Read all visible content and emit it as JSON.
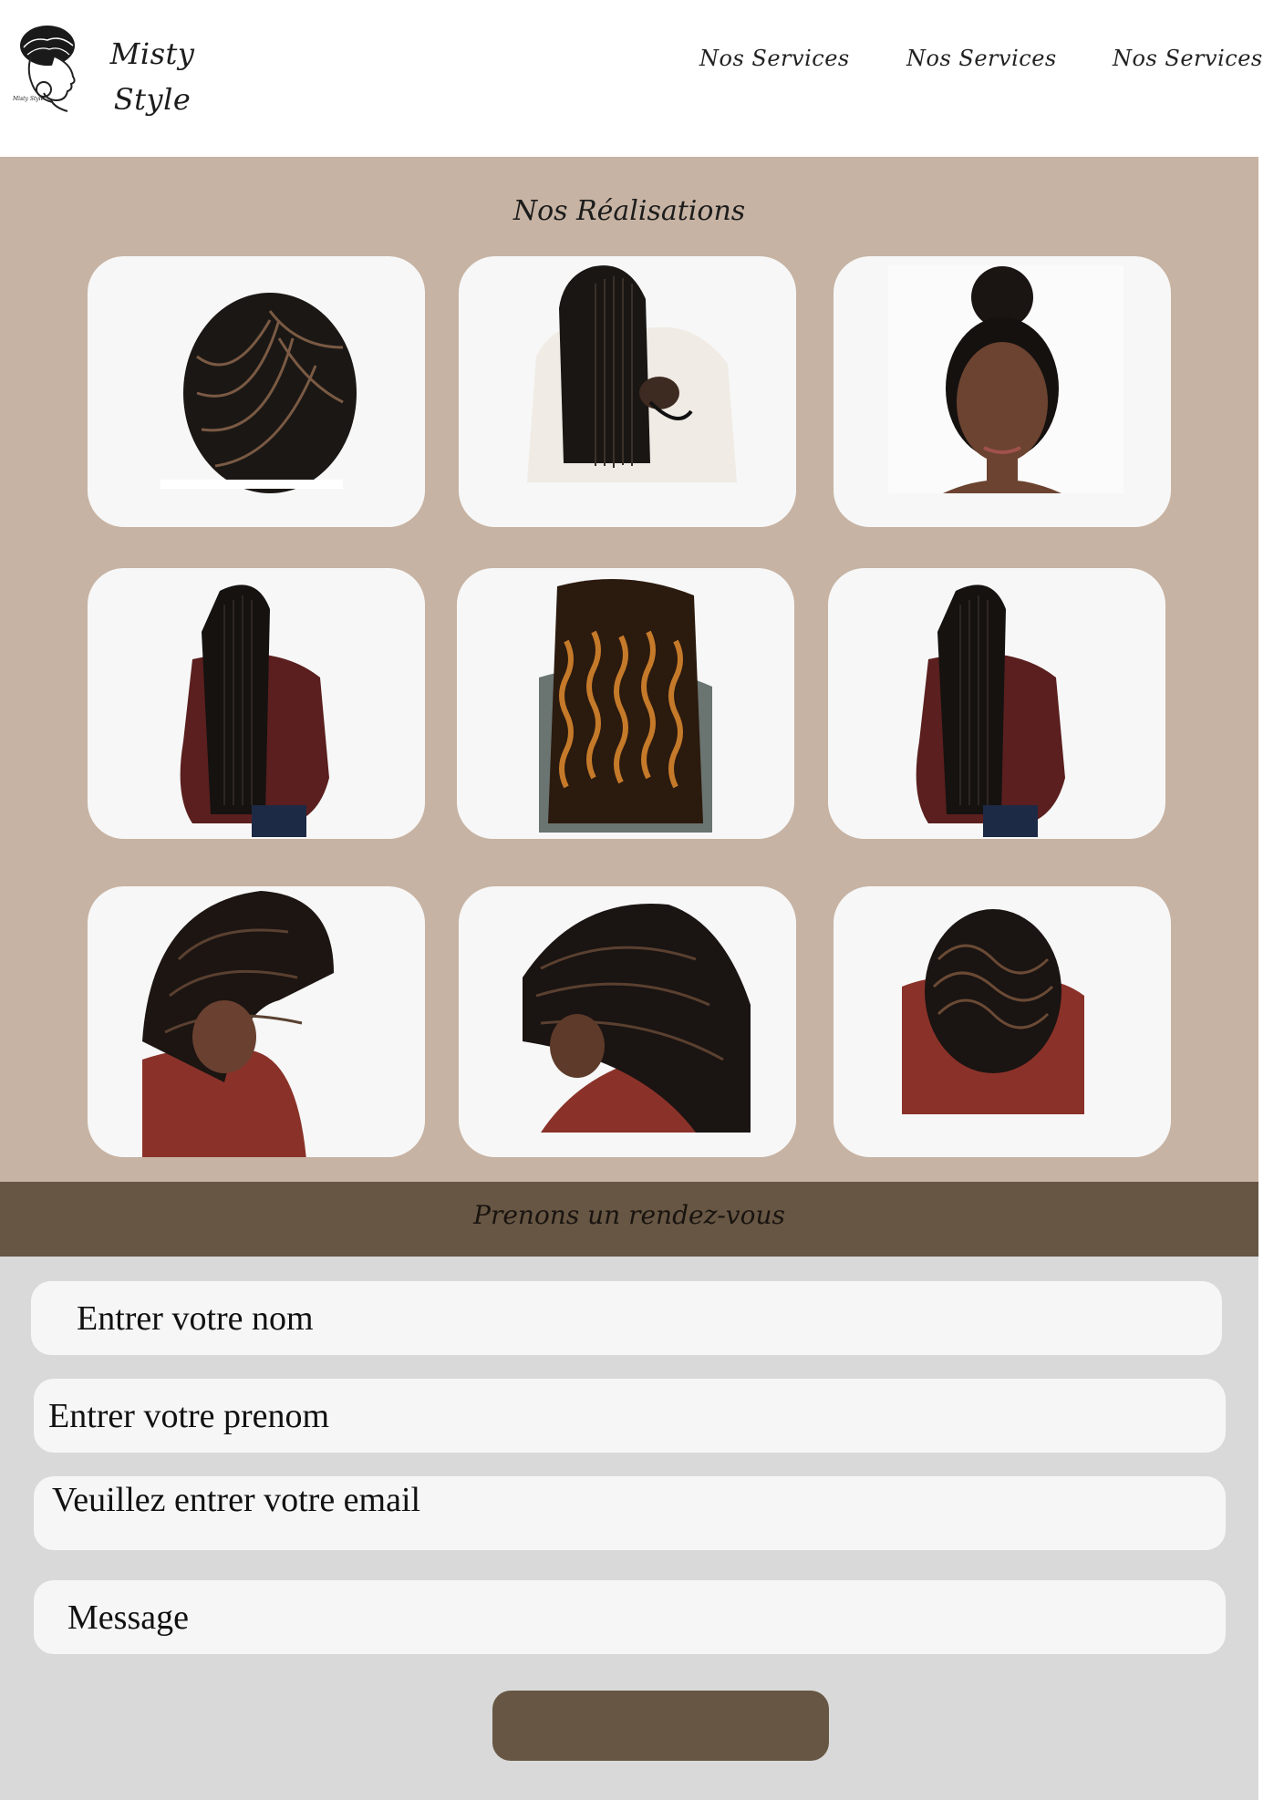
{
  "header": {
    "brand_line1": "Misty",
    "brand_line2": "Style",
    "logo_caption": "Misty Style",
    "nav": [
      "Nos Services",
      "Nos Services",
      "Nos Services"
    ]
  },
  "gallery": {
    "title": "Nos Réalisations",
    "items": [
      {
        "name": "cornrows-back-view"
      },
      {
        "name": "long-braids-front-view"
      },
      {
        "name": "high-bun-portrait"
      },
      {
        "name": "long-braids-curly-ends-back"
      },
      {
        "name": "curly-boho-braids-back"
      },
      {
        "name": "long-braids-curly-ends-side"
      },
      {
        "name": "stitch-braids-side"
      },
      {
        "name": "braids-bent-head"
      },
      {
        "name": "stitch-braids-top-view"
      }
    ]
  },
  "appointment": {
    "title": "Prenons un rendez-vous"
  },
  "form": {
    "nom_placeholder": "Entrer votre nom",
    "prenom_placeholder": "Entrer votre prenom",
    "email_placeholder": "Veuillez entrer votre email",
    "message_placeholder": "Message",
    "submit_label": ""
  },
  "colors": {
    "gallery_bg": "#c7b3a3",
    "accent_brown": "#665643",
    "form_bg": "#d9d9d9",
    "card_bg": "#f7f7f7"
  }
}
